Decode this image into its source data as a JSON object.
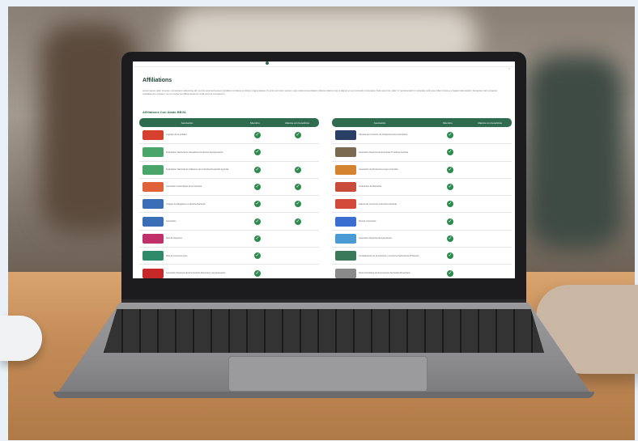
{
  "page": {
    "title": "Affiliations",
    "intro": "Lorem ipsum dolor sit amet, consectetur adipiscing elit, sed do eiusmod tempor incididunt ut labore et dolore magna aliqua. Ut enim ad minim veniam, quis nostrud exercitation ullamco laboris nisi ut aliquip ex ea commodo consequat. Duis aute irure dolor in reprehenderit in voluptate velit esse cillum dolore eu fugiat nulla pariatur. Excepteur sint occaecat cupidatat non proident, sunt in culpa qui officia deserunt mollit anim id est laborum.",
    "section_title": "Affiliations Con Alado BBVA",
    "close_label": "×",
    "colors": {
      "brand_green": "#2f6b4e",
      "check_green": "#2e8b4e"
    }
  },
  "tables": {
    "left": {
      "headers": [
        "Asociación",
        "Miembro",
        "Alianza con beneficios"
      ],
      "rows": [
        {
          "name": "Logotipo de la entidad",
          "logo": "#d6402f",
          "member": true,
          "alliance": true
        },
        {
          "name": "Federación Nacional de Ganaderos Productos Agropecuarios",
          "logo": "#4aa56a",
          "member": true,
          "alliance": false
        },
        {
          "name": "Federación Nacional de Cafeteros de Colombia Desarrollo Agrícola",
          "logo": "#4aa56a",
          "member": true,
          "alliance": true
        },
        {
          "name": "Asociación Colombiana de la Industria",
          "logo": "#e0623a",
          "member": true,
          "alliance": true
        },
        {
          "name": "Colegio de Abogados e Industria Nacional",
          "logo": "#3a6fb8",
          "member": true,
          "alliance": true
        },
        {
          "name": "Asociación",
          "logo": "#3a6fb8",
          "member": true,
          "alliance": true
        },
        {
          "name": "Red de Negocios",
          "logo": "#c0306a",
          "member": true,
          "alliance": false
        },
        {
          "name": "Red de Comercio justo",
          "logo": "#2f8a6a",
          "member": true,
          "alliance": false
        },
        {
          "name": "Asociación Nacional de Empresarios Alimentos y Agropecuarios",
          "logo": "#c62828",
          "member": true,
          "alliance": false
        }
      ]
    },
    "right": {
      "headers": [
        "Asociación",
        "Miembro",
        "Alianza con beneficios"
      ],
      "rows": [
        {
          "name": "Cámara de Comercio de Infraestructura Colombiana",
          "logo": "#2a3f66",
          "member": true,
          "alliance": false
        },
        {
          "name": "Asociación Nacional de Empresas Turísticas Andinas",
          "logo": "#7a6a50",
          "member": true,
          "alliance": false
        },
        {
          "name": "Asociación de Productores Agro Colombia",
          "logo": "#d4842e",
          "member": true,
          "alliance": false
        },
        {
          "name": "Federación de Bienestar",
          "logo": "#c94b3a",
          "member": true,
          "alliance": false
        },
        {
          "name": "Alianza de Comercio Colombia Industrial",
          "logo": "#d44a3a",
          "member": true,
          "alliance": false
        },
        {
          "name": "Red de Comercios",
          "logo": "#3a6fd0",
          "member": true,
          "alliance": false
        },
        {
          "name": "Asociación Nacional de Agua Rural",
          "logo": "#4a9ad6",
          "member": true,
          "alliance": false
        },
        {
          "name": "Confederación de la Industria y Comercio Nacional de Productos",
          "logo": "#3a7a5a",
          "member": true,
          "alliance": false
        },
        {
          "name": "Red Colombiana de Empresarios Sociedad Alimentaria",
          "logo": "#8a8a8a",
          "member": true,
          "alliance": false
        }
      ]
    }
  },
  "check_symbol": "✓"
}
